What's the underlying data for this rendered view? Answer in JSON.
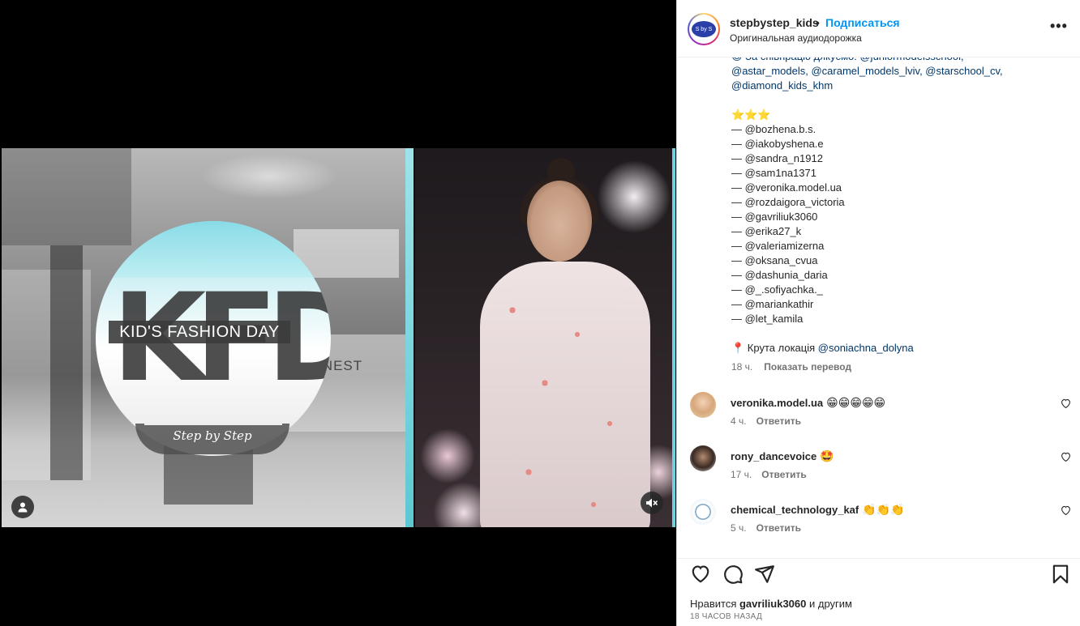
{
  "post": {
    "author": "stepbystep_kids",
    "separator": "•",
    "follow_label": "Подписаться",
    "audio": "Оригинальная аудиодорожка",
    "more_icon": "more-options-icon",
    "avatar_text": "S by S"
  },
  "video": {
    "logo_text": "KID'S FASHION DAY",
    "logo_letters": "KFD",
    "logo_tagline": "Step by Step",
    "background_sign": "ALNEST",
    "user_icon": "user-tag-icon",
    "mute_icon": "muted-speaker-icon"
  },
  "caption": {
    "line1": "😍 За співпрацю дякуємо: @juniormodelsschool,",
    "line2": "@astar_models, @caramel_models_lviv, @starschool_cv,",
    "line3": "@diamond_kids_khm",
    "stars": "⭐⭐⭐",
    "mentions": [
      "— @bozhena.b.s.",
      "— @iakobyshena.e",
      "— @sandra_n1912",
      "— @sam1na1371",
      "— @veronika.model.ua",
      "— @rozdaigora_victoria",
      "— @gavriliuk3060",
      "— @erika27_k",
      "— @valeriamizerna",
      "— @oksana_cvua",
      "— @dashunia_daria",
      "— @_.sofiyachka._",
      "— @mariankathir",
      "— @let_kamila"
    ],
    "location_prefix": "📍 Крута локація ",
    "location_mention": "@soniachna_dolyna",
    "time": "18 ч.",
    "translate": "Показать перевод"
  },
  "comments": [
    {
      "user": "veronika.model.ua",
      "text": "😁😁😁😁😁",
      "time": "4 ч.",
      "reply": "Ответить"
    },
    {
      "user": "rony_dancevoice",
      "text": "🤩",
      "time": "17 ч.",
      "reply": "Ответить"
    },
    {
      "user": "chemical_technology_kaf",
      "text": "👏👏👏",
      "time": "5 ч.",
      "reply": "Ответить"
    }
  ],
  "actions": {
    "like_icon": "heart-icon",
    "comment_icon": "comment-icon",
    "share_icon": "share-icon",
    "save_icon": "bookmark-icon"
  },
  "likes": {
    "prefix": "Нравится ",
    "user": "gavriliuk3060",
    "suffix": " и другим"
  },
  "timestamp": "18 ЧАСОВ НАЗАД",
  "colors": {
    "accent": "#0095f6",
    "mention": "#00376b",
    "muted": "#737373",
    "text": "#262626"
  }
}
